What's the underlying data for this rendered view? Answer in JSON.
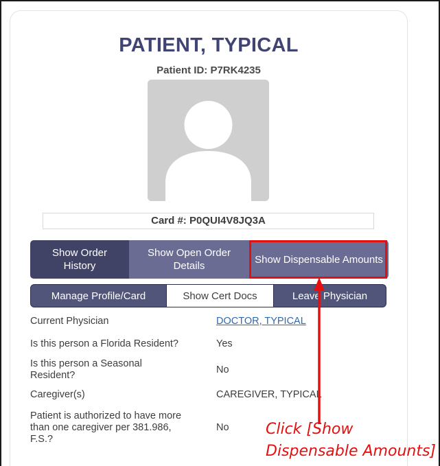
{
  "patient": {
    "name": "PATIENT, TYPICAL",
    "id_line": "Patient ID: P7RK4235",
    "card_line": "Card #: P0QUI4V8JQ3A"
  },
  "actions_row1": {
    "order_history": "Show Order History",
    "open_order_details": "Show Open Order Details",
    "dispensable_amounts": "Show Dispensable Amounts"
  },
  "actions_row2": {
    "manage_profile": "Manage Profile/Card",
    "cert_docs": "Show Cert Docs",
    "leave_physician": "Leave Physician"
  },
  "details": [
    {
      "label": "Current Physician",
      "value": "DOCTOR, TYPICAL"
    },
    {
      "label": "Is this person a Florida Resident?",
      "value": "Yes"
    },
    {
      "label": "Is this person a Seasonal Resident?",
      "value": "No"
    },
    {
      "label": "Caregiver(s)",
      "value": "CAREGIVER, TYPICAL"
    },
    {
      "label": "Patient is authorized to have more than one caregiver per 381.986, F.S.?",
      "value": "No"
    }
  ],
  "annotation": {
    "line1": "Click [Show",
    "line2": "Dispensable Amounts]"
  },
  "colors": {
    "title": "#3f4474",
    "button_dark": "#404266",
    "button_light": "#6a6c93",
    "highlight": "#e41010",
    "link": "#2d6ab0"
  }
}
